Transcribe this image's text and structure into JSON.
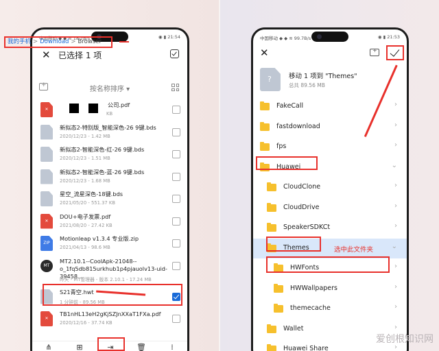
{
  "left": {
    "status_left": "中国移动 ◆ ◆ ≋ 18.7B/s",
    "status_right": "◉ ▮ 21:54",
    "title": "已选择 1 项",
    "breadcrumb": [
      "我的手机",
      "Download",
      "Browser"
    ],
    "sort_label": "按名称排序 ▾",
    "files": [
      {
        "icon": "pdf",
        "name": "公司.pdf",
        "meta": "KB",
        "checked": false
      },
      {
        "icon": "doc",
        "name": "新拟态2-特别版_智能深色-26 9键.bds",
        "meta": "2020/12/23 - 1.42 MB",
        "checked": false
      },
      {
        "icon": "doc",
        "name": "新拟态2-智能深色-红-26 9键.bds",
        "meta": "2020/12/23 - 1.51 MB",
        "checked": false
      },
      {
        "icon": "doc",
        "name": "新拟态2-智能深色-蓝-26 9键.bds",
        "meta": "2020/12/23 - 1.68 MB",
        "checked": false
      },
      {
        "icon": "doc",
        "name": "星空_流星深色-18键.bds",
        "meta": "2021/05/20 - 551.37 KB",
        "checked": false
      },
      {
        "icon": "pdf",
        "name": "DOU+电子发票.pdf",
        "meta": "2021/08/20 - 27.42 KB",
        "checked": false
      },
      {
        "icon": "zip",
        "name": "Motionleap v1.3.4 专业版.zip",
        "meta": "2021/04/13 - 98.6 MB",
        "checked": false
      },
      {
        "icon": "mt",
        "name": "MT2.10.1--CoolApk-21048--o_1fq5db815urkhub1p4pjauolv13-uid-39458…",
        "meta": "昨天 - MT管理器 - 版本 2.10.1 - 17.24 MB",
        "checked": false
      },
      {
        "icon": "doc",
        "name": "S21青空.hwt",
        "meta": "1 分钟前 - 89.56 MB",
        "checked": true
      },
      {
        "icon": "pdf",
        "name": "TB1nHL13eH2gKjSZJnXXaT1FXa.pdf",
        "meta": "2020/12/16 - 37.74 KB",
        "checked": false
      }
    ],
    "toolbar": [
      {
        "icon": "share-icon",
        "glyph": "⋔",
        "label": "分享"
      },
      {
        "icon": "copy-icon",
        "glyph": "⊞",
        "label": "复制"
      },
      {
        "icon": "move-icon",
        "glyph": "⇥",
        "label": "移动"
      },
      {
        "icon": "delete-icon",
        "glyph": "🗑",
        "label": "删除"
      },
      {
        "icon": "more-icon",
        "glyph": "⁞",
        "label": "更多"
      }
    ]
  },
  "right": {
    "status_left": "中国移动 ◆ ◆ ≋ 99.7B/s",
    "status_right": "◉ ▮ 21:53",
    "move_title": "移动 1 项到 \"Themes\"",
    "move_sub": "总共 89.56 MB",
    "folders": [
      {
        "name": "FakeCall",
        "level": 0
      },
      {
        "name": "fastdownload",
        "level": 0
      },
      {
        "name": "fps",
        "level": 0
      },
      {
        "name": "Huawei",
        "level": 0,
        "expanded": true
      },
      {
        "name": "CloudClone",
        "level": 1
      },
      {
        "name": "CloudDrive",
        "level": 1
      },
      {
        "name": "SpeakerSDKCt",
        "level": 1
      },
      {
        "name": "Themes",
        "level": 1,
        "selected": true,
        "expanded": true
      },
      {
        "name": "HWFonts",
        "level": 2
      },
      {
        "name": "HWWallpapers",
        "level": 2
      },
      {
        "name": "themecache",
        "level": 2
      },
      {
        "name": "Wallet",
        "level": 1
      },
      {
        "name": "Huawei Share",
        "level": 1
      }
    ],
    "select_note": "选中此文件夹"
  },
  "watermark": "爱创根知识网",
  "colors": {
    "accent": "#1a6bd8",
    "annotation": "#e8302b",
    "folder": "#f6c02d"
  }
}
